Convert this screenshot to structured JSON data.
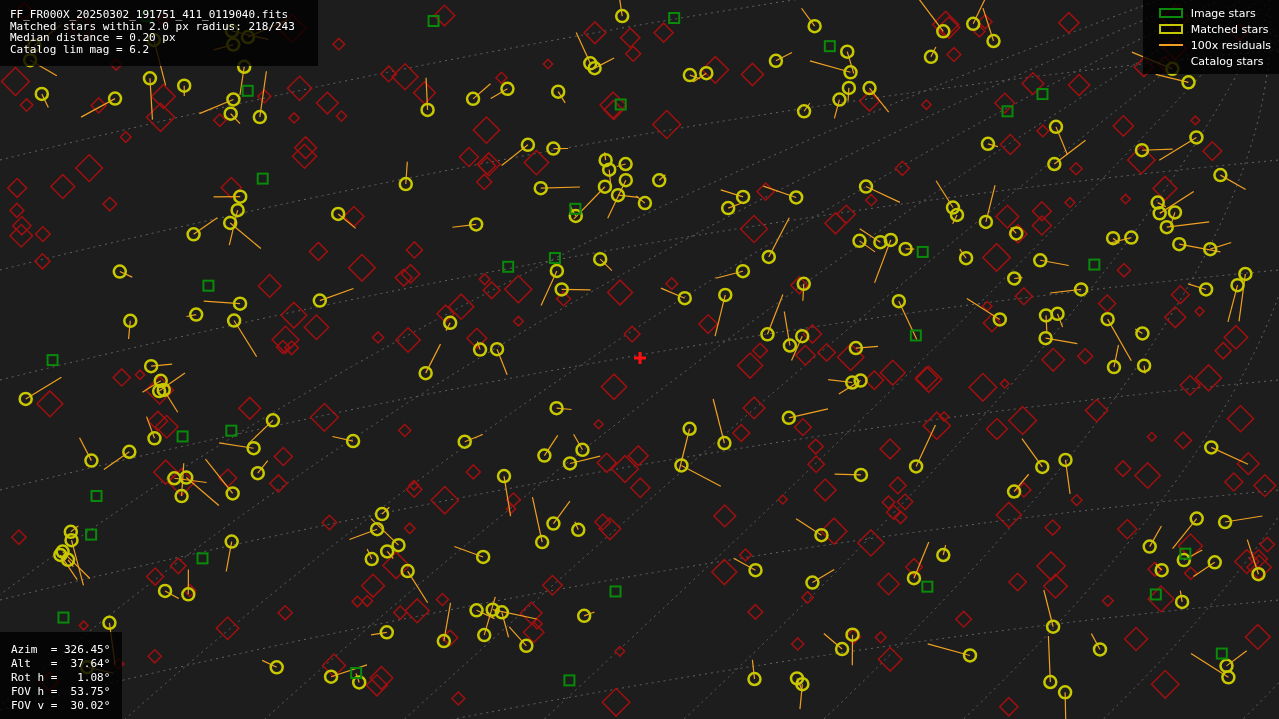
{
  "info": {
    "lines": [
      "FF_FR000X_20250302_191751_411_0119040.fits",
      "Matched stars within 2.0 px radius: 218/243",
      "Median distance = 0.20 px",
      "Catalog lim mag = 6.2"
    ]
  },
  "legend": [
    {
      "kind": "image",
      "label": "Image stars"
    },
    {
      "kind": "matched",
      "label": "Matched stars"
    },
    {
      "kind": "residual",
      "label": "100x residuals"
    },
    {
      "kind": "catalog",
      "label": "Catalog stars"
    }
  ],
  "pointing": {
    "lines": [
      "Azim  = 326.45°",
      "Alt   =  37.64°",
      "Rot h =   1.08°",
      "FOV h =  53.75°",
      "FOV v =  30.02°"
    ]
  }
}
